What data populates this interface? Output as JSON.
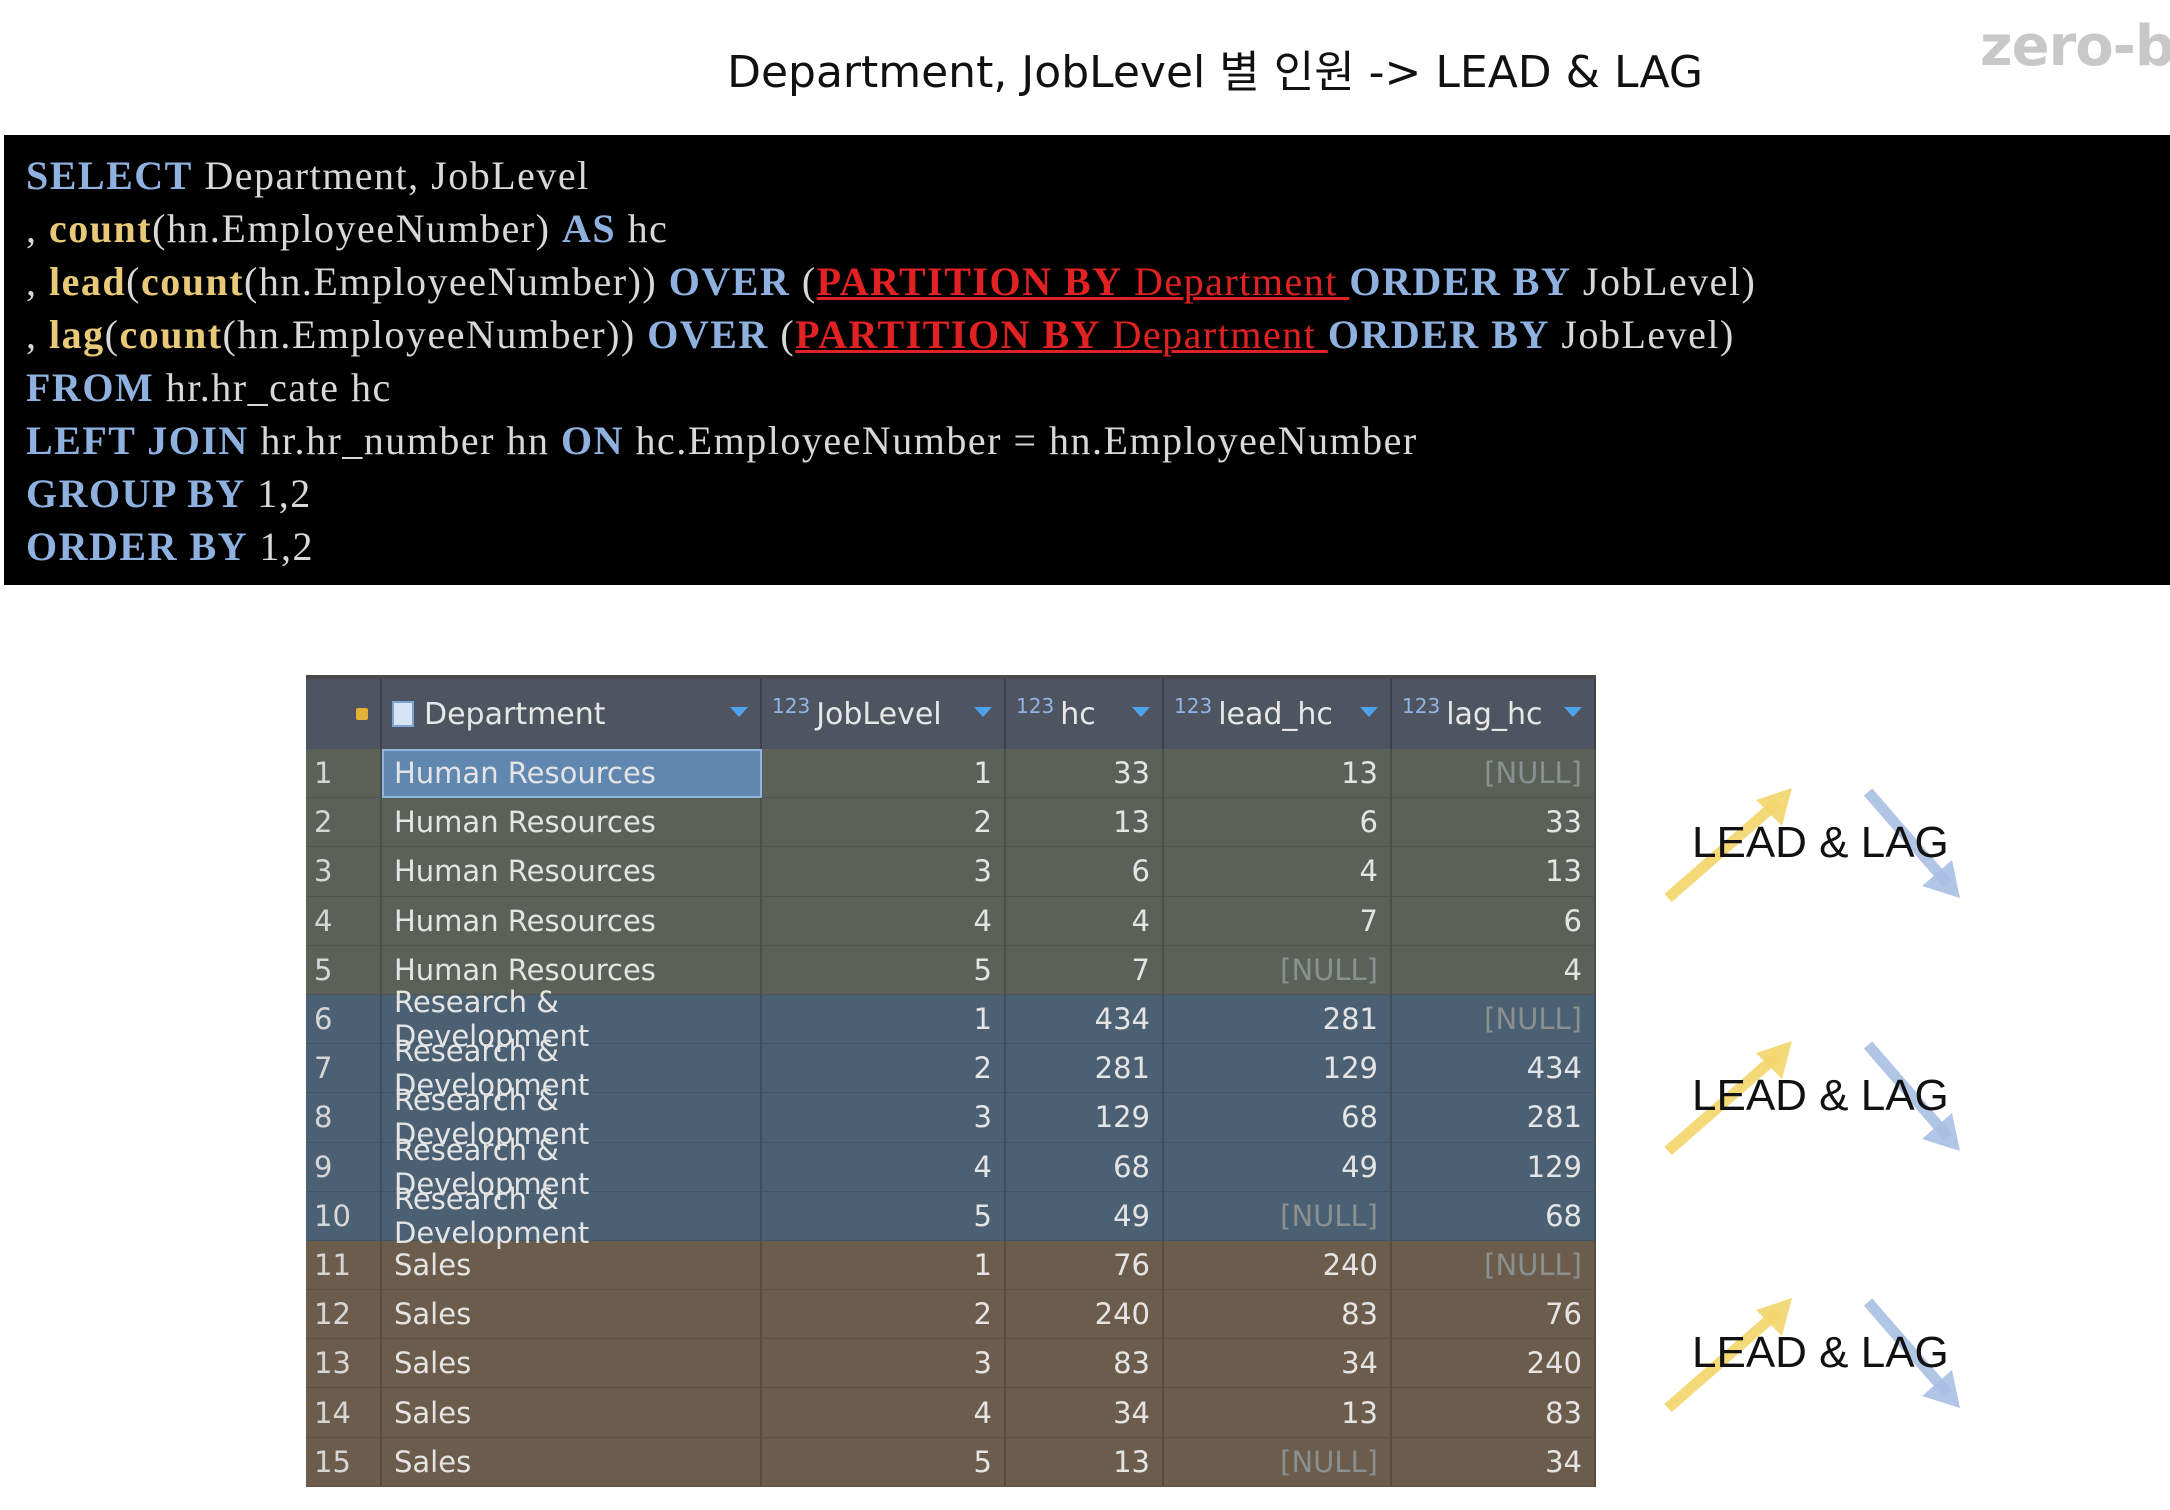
{
  "title": "Department, JobLevel 별 인원 -> LEAD & LAG",
  "brand": "zero-b",
  "code": {
    "l1": {
      "select": "SELECT",
      "rest": " Department, JobLevel"
    },
    "l2": {
      "comma": ", ",
      "count": "count",
      "args": "(hn.EmployeeNumber) ",
      "as": "AS",
      "alias": " hc"
    },
    "l3": {
      "comma": ", ",
      "fn": "lead",
      "p1": "(",
      "count": "count",
      "args": "(hn.EmployeeNumber)) ",
      "over": "OVER",
      "p2": " (",
      "partition": "PARTITION BY",
      "dept": " Department ",
      "order": "ORDER BY",
      "tail": " JobLevel)"
    },
    "l4": {
      "comma": ", ",
      "fn": "lag",
      "p1": "(",
      "count": "count",
      "args": "(hn.EmployeeNumber)) ",
      "over": "OVER",
      "p2": " (",
      "partition": "PARTITION BY",
      "dept": " Department ",
      "order": "ORDER BY",
      "tail": " JobLevel)"
    },
    "l5": {
      "from": "FROM",
      "rest": " hr.hr_cate hc"
    },
    "l6": {
      "left": "LEFT JOIN",
      "t": " hr.hr_number hn ",
      "on": "ON",
      "rest": " hc.EmployeeNumber = hn.EmployeeNumber"
    },
    "l7": {
      "kw": "GROUP BY",
      "rest": " 1,2"
    },
    "l8": {
      "kw": "ORDER BY",
      "rest": " 1,2"
    }
  },
  "grid": {
    "columns": {
      "dept": "Department",
      "type_label": "123",
      "job": "JobLevel",
      "hc": "hc",
      "lead": "lead_hc",
      "lag": "lag_hc"
    },
    "rows": [
      {
        "n": "1",
        "dept": "Human Resources",
        "job": "1",
        "hc": "33",
        "lead": "13",
        "lag": "[NULL]"
      },
      {
        "n": "2",
        "dept": "Human Resources",
        "job": "2",
        "hc": "13",
        "lead": "6",
        "lag": "33"
      },
      {
        "n": "3",
        "dept": "Human Resources",
        "job": "3",
        "hc": "6",
        "lead": "4",
        "lag": "13"
      },
      {
        "n": "4",
        "dept": "Human Resources",
        "job": "4",
        "hc": "4",
        "lead": "7",
        "lag": "6"
      },
      {
        "n": "5",
        "dept": "Human Resources",
        "job": "5",
        "hc": "7",
        "lead": "[NULL]",
        "lag": "4"
      },
      {
        "n": "6",
        "dept": "Research & Development",
        "job": "1",
        "hc": "434",
        "lead": "281",
        "lag": "[NULL]"
      },
      {
        "n": "7",
        "dept": "Research & Development",
        "job": "2",
        "hc": "281",
        "lead": "129",
        "lag": "434"
      },
      {
        "n": "8",
        "dept": "Research & Development",
        "job": "3",
        "hc": "129",
        "lead": "68",
        "lag": "281"
      },
      {
        "n": "9",
        "dept": "Research & Development",
        "job": "4",
        "hc": "68",
        "lead": "49",
        "lag": "129"
      },
      {
        "n": "10",
        "dept": "Research & Development",
        "job": "5",
        "hc": "49",
        "lead": "[NULL]",
        "lag": "68"
      },
      {
        "n": "11",
        "dept": "Sales",
        "job": "1",
        "hc": "76",
        "lead": "240",
        "lag": "[NULL]"
      },
      {
        "n": "12",
        "dept": "Sales",
        "job": "2",
        "hc": "240",
        "lead": "83",
        "lag": "76"
      },
      {
        "n": "13",
        "dept": "Sales",
        "job": "3",
        "hc": "83",
        "lead": "34",
        "lag": "240"
      },
      {
        "n": "14",
        "dept": "Sales",
        "job": "4",
        "hc": "34",
        "lead": "13",
        "lag": "83"
      },
      {
        "n": "15",
        "dept": "Sales",
        "job": "5",
        "hc": "13",
        "lead": "[NULL]",
        "lag": "34"
      }
    ]
  },
  "side_labels": [
    "LEAD & LAG",
    "LEAD & LAG",
    "LEAD & LAG"
  ],
  "colors": {
    "arrow_up": "#f3d56b",
    "arrow_down": "#a9bfe3",
    "group_hr": "#5b6158",
    "group_rd": "#4c6073",
    "group_sales": "#6c5c4b"
  }
}
